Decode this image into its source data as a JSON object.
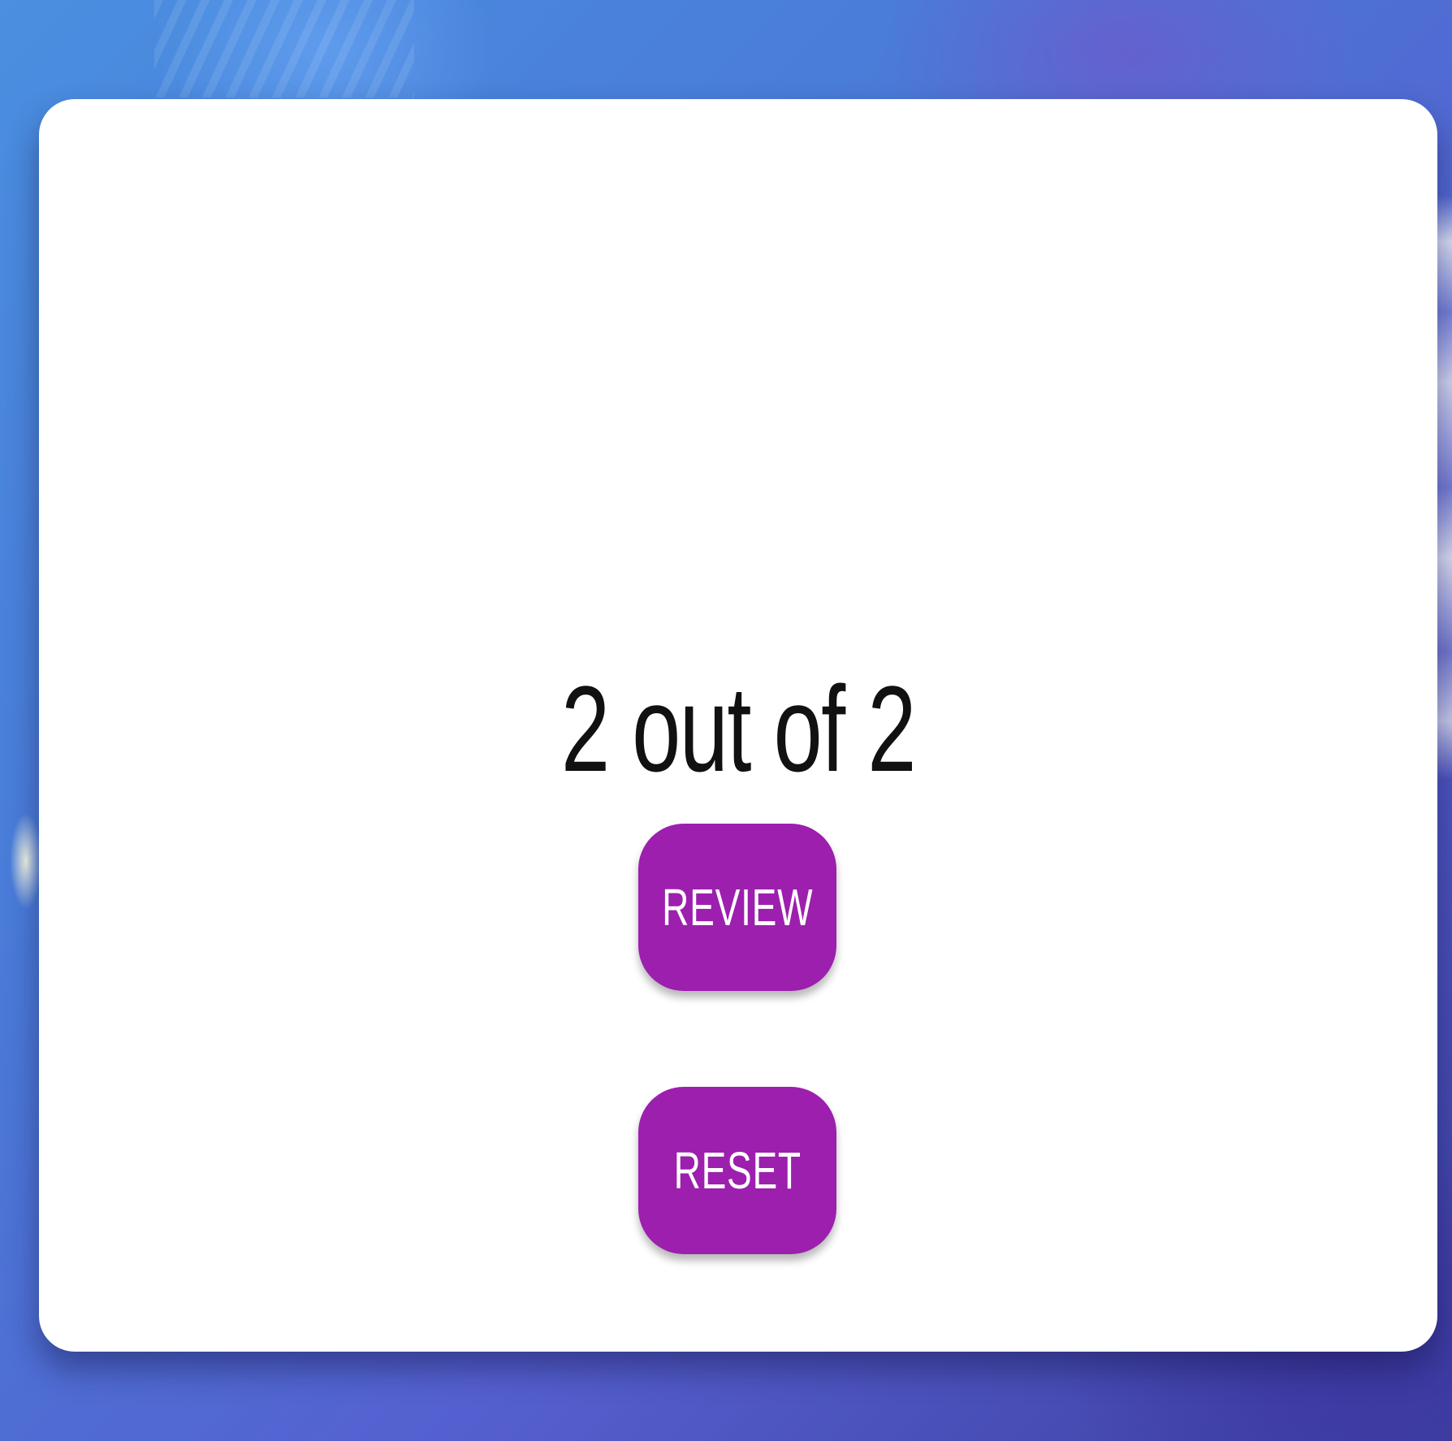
{
  "result": {
    "score_text": "2 out of 2"
  },
  "actions": {
    "review_label": "REVIEW",
    "reset_label": "RESET"
  },
  "colors": {
    "button_bg": "#9c1fae",
    "button_text": "#ffffff",
    "card_bg": "#ffffff",
    "score_text": "#111111"
  }
}
